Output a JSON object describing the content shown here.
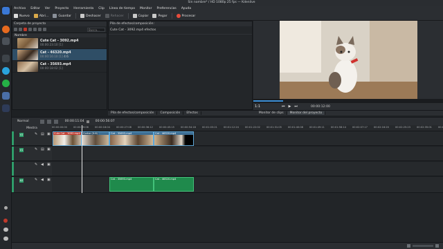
{
  "window": {
    "title": "Sin nombre* / HD 1080p 25 fps — Kdenlive"
  },
  "menu": [
    "Archivo",
    "Editar",
    "Ver",
    "Proyecto",
    "Herramienta",
    "Clip",
    "Línea de tiempo",
    "Monitor",
    "Preferencias",
    "Ayuda"
  ],
  "toolbar": {
    "new": "Nuevo",
    "open": "Abri...",
    "save": "Guardar",
    "undo": "Deshacer",
    "redo": "Rehacer",
    "copy": "Copiar",
    "paste": "Pegar",
    "render": "Procesar"
  },
  "bin": {
    "title": "Carpeta de proyecto",
    "search_placeholder": "Busca...",
    "column": "Nombre",
    "clips": [
      {
        "name": "Cute Cat - 3092.mp4",
        "duration": "00:00:23:10 [1]",
        "tag": ""
      },
      {
        "name": "Cat - 46320.mp4",
        "duration": "00:00:16:10 [1]",
        "tag": "4:6"
      },
      {
        "name": "Cat - 35693.mp4",
        "duration": "00:00:18:02 [1]",
        "tag": ""
      }
    ]
  },
  "effects": {
    "title": "Pila de efectos/composición:",
    "selected": "Cute Cat - 3092.mp4 efectos"
  },
  "monitor": {
    "zoom": "1:1",
    "timecode": "00:00:12:00"
  },
  "tabs": [
    "Pila de efectos/composición",
    "Composición",
    "Efectos",
    "Monitor de clips",
    "Monitor del proyecto"
  ],
  "timeline": {
    "mode": "Normal",
    "timecode": "00:00:11:04",
    "timecode2": "00:00:56:07",
    "master": "Mestra",
    "ruler": [
      "00:00:00:00",
      "00:00:09:06",
      "00:00:18:04",
      "00:00:27:08",
      "00:00:36:12",
      "00:00:45:15",
      "00:00:54:18",
      "00:01:03:21",
      "00:01:12:24",
      "00:01:22:02",
      "00:01:31:05",
      "00:01:40:08",
      "00:01:49:11",
      "00:01:58:14",
      "00:02:07:17",
      "00:02:16:20",
      "00:02:25:23",
      "00:02:35:01",
      "00:02:44:04"
    ],
    "video_clips": [
      "Cute Cat - 3092.mp4",
      "Cortar (0:6)",
      "Cat - 35693.mp4",
      "Cat - 46320.mp4"
    ],
    "audio_clips": [
      "Cat - 35693.mp4",
      "Cat - 46320.mp4"
    ],
    "tracks": [
      "V2",
      "V1",
      "A1",
      "A2"
    ]
  }
}
